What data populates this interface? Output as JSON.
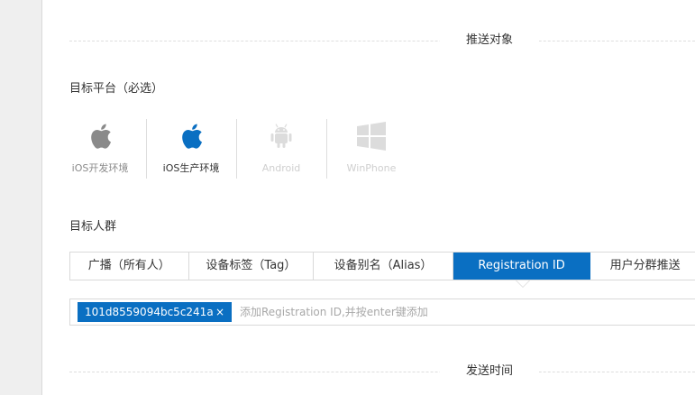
{
  "section_target": {
    "title": "推送对象"
  },
  "platform_field": {
    "label": "目标平台（必选）",
    "platforms": [
      {
        "label": "iOS开发环境",
        "icon": "apple-icon",
        "color": "#8a8a8a",
        "state": "enabled"
      },
      {
        "label": "iOS生产环境",
        "icon": "apple-icon",
        "color": "#0a6fc2",
        "state": "selected"
      },
      {
        "label": "Android",
        "icon": "android-icon",
        "color": "#dddddd",
        "state": "disabled"
      },
      {
        "label": "WinPhone",
        "icon": "windows-icon",
        "color": "#dddddd",
        "state": "disabled"
      }
    ]
  },
  "audience_field": {
    "label": "目标人群",
    "tabs": [
      {
        "label": "广播（所有人）",
        "active": false
      },
      {
        "label": "设备标签（Tag）",
        "active": false
      },
      {
        "label": "设备别名（Alias）",
        "active": false
      },
      {
        "label": "Registration ID",
        "active": true
      },
      {
        "label": "用户分群推送",
        "active": false
      }
    ],
    "tag_input": {
      "tags": [
        {
          "text": "101d8559094bc5c241a",
          "remove": "×"
        }
      ],
      "placeholder": "添加Registration ID,并按enter键添加"
    }
  },
  "section_time": {
    "title": "发送时间"
  },
  "colors": {
    "accent": "#0a6fc2",
    "border": "#d9d9d9",
    "muted": "#a8a8a8"
  }
}
